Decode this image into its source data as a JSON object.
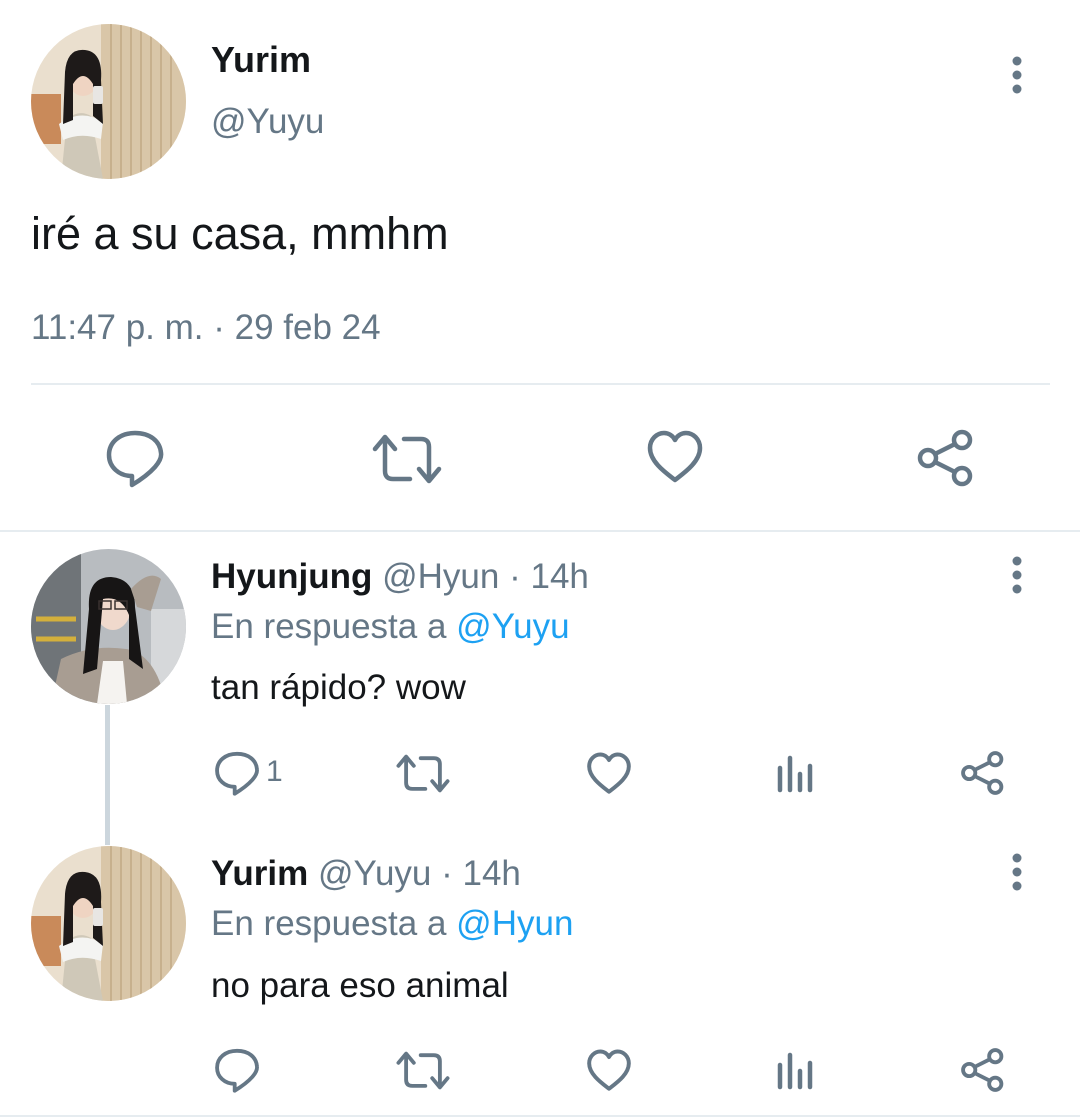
{
  "main_tweet": {
    "display_name": "Yurim",
    "handle": "@Yuyu",
    "text": "iré a su casa, mmhm",
    "timestamp": "11:47 p. m. · 29 feb 24",
    "actions": [
      "reply-icon",
      "retweet-icon",
      "like-icon",
      "share-icon"
    ]
  },
  "replies": [
    {
      "display_name": "Hyunjung",
      "handle": "@Hyun",
      "separator": "·",
      "time": "14h",
      "reply_prefix": "En respuesta a",
      "reply_to": "@Yuyu",
      "text": "tan rápido? wow",
      "reply_count": "1",
      "actions": [
        "reply-icon",
        "retweet-icon",
        "like-icon",
        "analytics-icon",
        "share-icon"
      ]
    },
    {
      "display_name": "Yurim",
      "handle": "@Yuyu",
      "separator": "·",
      "time": "14h",
      "reply_prefix": "En respuesta a",
      "reply_to": "@Hyun",
      "text": "no para eso animal",
      "reply_count": "",
      "actions": [
        "reply-icon",
        "retweet-icon",
        "like-icon",
        "analytics-icon",
        "share-icon"
      ]
    }
  ],
  "colors": {
    "text": "#14171a",
    "secondary": "#657786",
    "link": "#1da1f2",
    "divider": "#e6ecf0"
  }
}
